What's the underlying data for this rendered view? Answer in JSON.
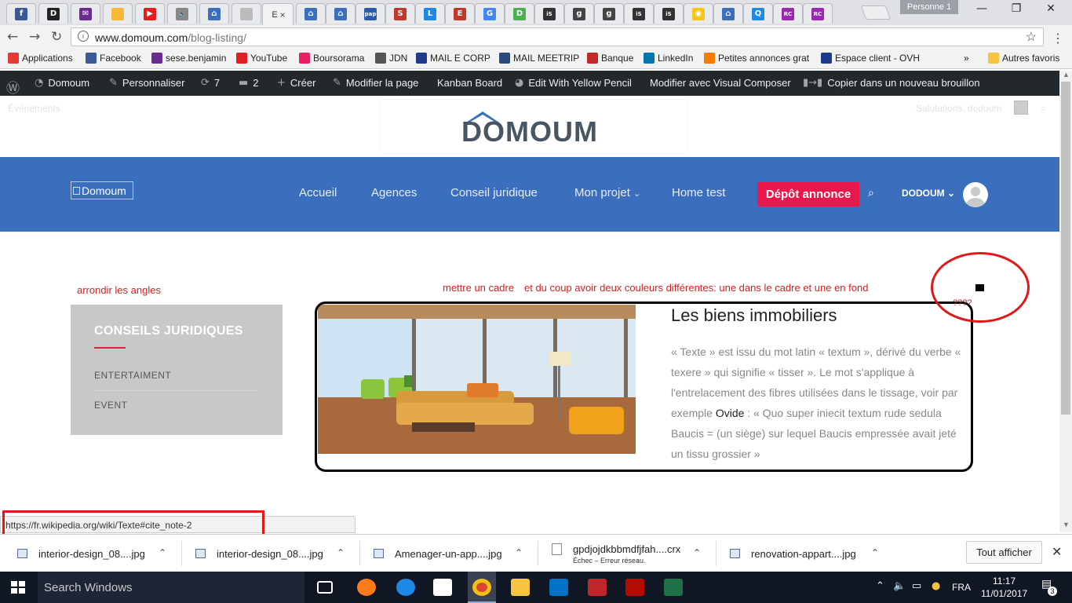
{
  "browser": {
    "tabs": [
      {
        "icon": "facebook-icon",
        "letter": "f",
        "color": "#3b5998"
      },
      {
        "icon": "d-icon",
        "letter": "D",
        "color": "#222222"
      },
      {
        "icon": "mail-icon",
        "letter": "✉",
        "color": "#6b2c91"
      },
      {
        "icon": "yellow-square-icon",
        "letter": "",
        "color": "#f6b93b"
      },
      {
        "icon": "youtube-icon",
        "letter": "▶",
        "color": "#e02020"
      },
      {
        "icon": "sound-icon",
        "letter": "🔈",
        "color": "#888888"
      },
      {
        "icon": "house-icon",
        "letter": "⌂",
        "color": "#3b6fbe"
      },
      {
        "icon": "page-icon",
        "letter": "",
        "color": "#bbbbbb"
      }
    ],
    "active_tab": {
      "title": "E",
      "close": "×"
    },
    "tabs_right": [
      {
        "icon": "house-icon",
        "letter": "⌂",
        "color": "#3b6fbe"
      },
      {
        "icon": "house-icon",
        "letter": "⌂",
        "color": "#3b6fbe"
      },
      {
        "icon": "pap-icon",
        "letter": "pap",
        "color": "#2a5caa"
      },
      {
        "icon": "sb-icon",
        "letter": "S",
        "color": "#c0392b"
      },
      {
        "icon": "li-icon",
        "letter": "L",
        "color": "#1e88e5"
      },
      {
        "icon": "e-icon",
        "letter": "E",
        "color": "#c0392b"
      },
      {
        "icon": "google-icon",
        "letter": "G",
        "color": "#4285f4"
      },
      {
        "icon": "d-green-icon",
        "letter": "D",
        "color": "#4caf50"
      },
      {
        "icon": "is-icon",
        "letter": "iS",
        "color": "#333333"
      },
      {
        "icon": "g-icon",
        "letter": "g",
        "color": "#444444"
      },
      {
        "icon": "g-icon",
        "letter": "g",
        "color": "#444444"
      },
      {
        "icon": "is-icon",
        "letter": "iS",
        "color": "#333333"
      },
      {
        "icon": "is-icon",
        "letter": "iS",
        "color": "#333333"
      },
      {
        "icon": "yellow-icon",
        "letter": "◉",
        "color": "#f5c518"
      },
      {
        "icon": "house-icon",
        "letter": "⌂",
        "color": "#3b6fbe"
      },
      {
        "icon": "search-icon",
        "letter": "Q",
        "color": "#1e88e5"
      },
      {
        "icon": "rc-icon",
        "letter": "RC",
        "color": "#9c27b0"
      },
      {
        "icon": "rc-icon",
        "letter": "RC",
        "color": "#9c27b0"
      }
    ],
    "profile": "Personne 1",
    "window": {
      "minimize": "—",
      "restore": "❐",
      "close": "✕"
    },
    "nav": {
      "back": "←",
      "forward": "→",
      "reload": "↻"
    },
    "url_host": "www.domoum.com",
    "url_path": "/blog-listing/",
    "star": "☆",
    "menu": "⋮"
  },
  "bookmarks": [
    {
      "label": "Applications",
      "color": "#e53935"
    },
    {
      "label": "Facebook",
      "color": "#3b5998"
    },
    {
      "label": "sese.benjamin",
      "color": "#6b2c91"
    },
    {
      "label": "YouTube",
      "color": "#e02020"
    },
    {
      "label": "Boursorama",
      "color": "#e91e63"
    },
    {
      "label": "JDN",
      "color": "#555555"
    },
    {
      "label": "MAIL E CORP",
      "color": "#1e3a8a"
    },
    {
      "label": "MAIL MEETRIP",
      "color": "#2a4a7a"
    },
    {
      "label": "Banque",
      "color": "#c62828"
    },
    {
      "label": "LinkedIn",
      "color": "#0077b5"
    },
    {
      "label": "Petites annonces grat",
      "color": "#f57c00"
    },
    {
      "label": "Espace client - OVH",
      "color": "#1e3a8a"
    }
  ],
  "bookmarks_more": "»",
  "bookmarks_other": "Autres favoris",
  "wpbar": {
    "site": "Domoum",
    "customize": "Personnaliser",
    "updates": "7",
    "comments": "2",
    "new": "Créer",
    "edit": "Modifier la page",
    "kanban": "Kanban Board",
    "yellow_pencil": "Edit With Yellow Pencil",
    "visual_composer": "Modifier avec Visual Composer",
    "copy_draft": "Copier dans un nouveau brouillon"
  },
  "site": {
    "events": "Événements",
    "greeting": "Salutations, dodoum",
    "logo": "DOMOUM",
    "broken_logo_alt": "Domoum",
    "nav": [
      "Accueil",
      "Agences",
      "Conseil juridique",
      "Mon projet",
      "Home test"
    ],
    "depot": "Dépôt annonce",
    "user": "DODOUM"
  },
  "annotations": {
    "rounded_corners": "arrondir les angles",
    "frame": "mettre un cadre",
    "two_colors": "et du coup avoir deux couleurs différentes: une dans le cadre et une en fond",
    "question": "????"
  },
  "sidebar": {
    "title": "CONSEILS JURIDIQUES",
    "items": [
      "ENTERTAIMENT",
      "EVENT"
    ]
  },
  "card": {
    "title": "Les biens immobiliers",
    "text_before": "« Texte » est issu du mot latin « textum », dérivé du verbe « texere » qui signifie « tisser ». Le mot s'applique à l'entrelacement des fibres utilisées dans le tissage, voir par exemple ",
    "link": "Ovide",
    "text_after": " : « Quo super iniecit textum rude sedula Baucis = (un siège) sur lequel Baucis empressée avait jeté un tissu grossier »"
  },
  "status_url": "https://fr.wikipedia.org/wiki/Texte#cite_note-2",
  "downloads": [
    {
      "name": "interior-design_08....jpg",
      "sub": ""
    },
    {
      "name": "interior-design_08....jpg",
      "sub": ""
    },
    {
      "name": "Amenager-un-app....jpg",
      "sub": ""
    },
    {
      "name": "gpdjojdkbbmdfjfah....crx",
      "sub": "Échec – Erreur réseau."
    },
    {
      "name": "renovation-appart....jpg",
      "sub": ""
    }
  ],
  "downloads_show_all": "Tout afficher",
  "taskbar": {
    "search": "Search Windows",
    "lang": "FRA",
    "time": "11:17",
    "date": "11/01/2017",
    "notifications": "3"
  }
}
